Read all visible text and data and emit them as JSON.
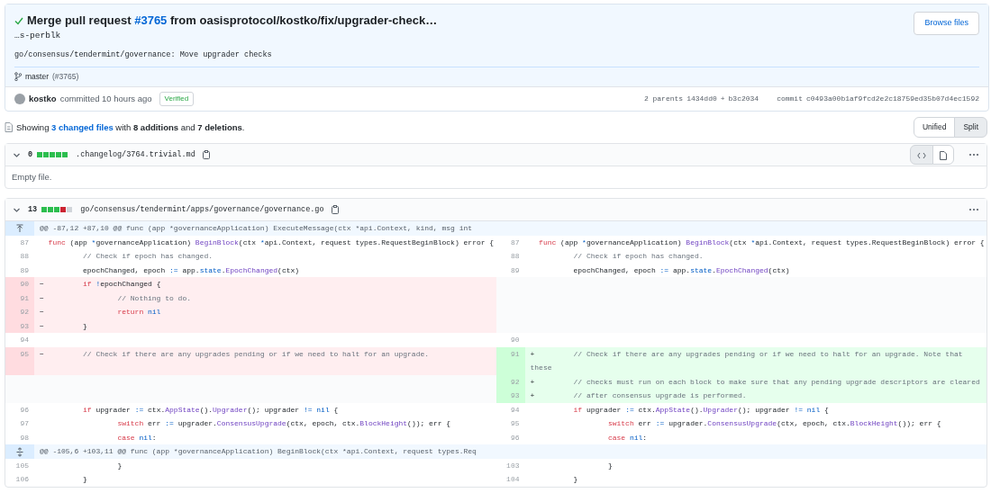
{
  "commit": {
    "title_prefix": "Merge pull request ",
    "pr_link": "#3765",
    "title_suffix": " from oasisprotocol/kostko/fix/upgrader-check…",
    "continuation": "…s-perblk",
    "message": "go/consensus/tendermint/governance: Move upgrader checks",
    "browse_button": "Browse files",
    "branch": "master",
    "branch_pr": "(#3765)",
    "author": "kostko",
    "action": "committed 10 hours ago",
    "verified": "Verified",
    "parents_label": "2 parents",
    "parent_1": "1434dd0",
    "parents_separator": "+",
    "parent_2": "b3c2034",
    "commit_label": "commit",
    "sha": "c0493a00b1af9fcd2e2c18759ed35b07d4ec1592"
  },
  "summary": {
    "prefix": "Showing ",
    "link": "3 changed files",
    "suffix": " with **8 additions** and **7 deletions**."
  },
  "view_toggle": [
    {
      "label": "Unified",
      "selected": false
    },
    {
      "label": "Split",
      "selected": true
    }
  ],
  "files": [
    {
      "count": "0",
      "diffstat": [
        {
          "color": "#2cbe4e"
        },
        {
          "color": "#2cbe4e"
        },
        {
          "color": "#2cbe4e"
        },
        {
          "color": "#2cbe4e"
        },
        {
          "color": "#2cbe4e"
        }
      ],
      "path": ".changelog/3764.trivial.md",
      "expanded": true,
      "body": "Empty file."
    },
    {
      "count": "13",
      "diffstat": [
        {
          "color": "#2cbe4e"
        },
        {
          "color": "#2cbe4e"
        },
        {
          "color": "#2cbe4e"
        },
        {
          "color": "#cb2431"
        },
        {
          "color": "#d1d5da"
        }
      ],
      "path": "go/consensus/tendermint/apps/governance/governance.go",
      "expanded": true,
      "rows": [
        {
          "kind": "hunk",
          "expand_both": false,
          "text": "@@ -87,12 +87,10 @@ func (app *governanceApplication) ExecuteMessage(ctx *api.Context, kind, msg int"
        },
        {
          "kind": "pair",
          "left": {
            "kind": "context",
            "number": "87",
            "tokens": [
              {
                "kind": "keyword",
                "text": "func"
              },
              {
                "kind": "plain",
                "text": " (app "
              },
              {
                "kind": "constant",
                "text": "*"
              },
              {
                "kind": "plain",
                "text": "governanceApplication) "
              },
              {
                "kind": "function",
                "text": "BeginBlock"
              },
              {
                "kind": "plain",
                "text": "(ctx "
              },
              {
                "kind": "constant",
                "text": "*"
              },
              {
                "kind": "plain",
                "text": "api.Context, request types.RequestBeginBlock) error {"
              }
            ]
          },
          "right": {
            "kind": "context",
            "number": "87",
            "tokens": [
              {
                "kind": "keyword",
                "text": "func"
              },
              {
                "kind": "plain",
                "text": " (app "
              },
              {
                "kind": "constant",
                "text": "*"
              },
              {
                "kind": "plain",
                "text": "governanceApplication) "
              },
              {
                "kind": "function",
                "text": "BeginBlock"
              },
              {
                "kind": "plain",
                "text": "(ctx "
              },
              {
                "kind": "constant",
                "text": "*"
              },
              {
                "kind": "plain",
                "text": "api.Context, request types.RequestBeginBlock) error {"
              }
            ]
          }
        },
        {
          "kind": "pair",
          "left": {
            "kind": "context",
            "number": "88",
            "tokens": [
              {
                "kind": "comment",
                "text": "        // Check if epoch has changed."
              }
            ]
          },
          "right": {
            "kind": "context",
            "number": "88",
            "tokens": [
              {
                "kind": "comment",
                "text": "        // Check if epoch has changed."
              }
            ]
          }
        },
        {
          "kind": "pair",
          "left": {
            "kind": "context",
            "number": "89",
            "tokens": [
              {
                "kind": "plain",
                "text": "        epochChanged, epoch "
              },
              {
                "kind": "constant",
                "text": ":="
              },
              {
                "kind": "plain",
                "text": " app."
              },
              {
                "kind": "constant",
                "text": "state"
              },
              {
                "kind": "plain",
                "text": "."
              },
              {
                "kind": "function",
                "text": "EpochChanged"
              },
              {
                "kind": "plain",
                "text": "(ctx)"
              }
            ]
          },
          "right": {
            "kind": "context",
            "number": "89",
            "tokens": [
              {
                "kind": "plain",
                "text": "        epochChanged, epoch "
              },
              {
                "kind": "constant",
                "text": ":="
              },
              {
                "kind": "plain",
                "text": " app."
              },
              {
                "kind": "constant",
                "text": "state"
              },
              {
                "kind": "plain",
                "text": "."
              },
              {
                "kind": "function",
                "text": "EpochChanged"
              },
              {
                "kind": "plain",
                "text": "(ctx)"
              }
            ]
          }
        },
        {
          "kind": "pair",
          "left": {
            "kind": "deletion",
            "number": "90",
            "sign": "−",
            "tokens": [
              {
                "kind": "keyword",
                "text": "        if"
              },
              {
                "kind": "constant",
                "text": " !"
              },
              {
                "kind": "plain",
                "text": "epochChanged {"
              }
            ]
          },
          "right": {
            "kind": "empty"
          }
        },
        {
          "kind": "pair",
          "left": {
            "kind": "deletion",
            "number": "91",
            "sign": "−",
            "tokens": [
              {
                "kind": "comment",
                "text": "                // Nothing to do."
              }
            ]
          },
          "right": {
            "kind": "empty"
          }
        },
        {
          "kind": "pair",
          "left": {
            "kind": "deletion",
            "number": "92",
            "sign": "−",
            "tokens": [
              {
                "kind": "keyword",
                "text": "                return"
              },
              {
                "kind": "constant",
                "text": " nil"
              }
            ]
          },
          "right": {
            "kind": "empty"
          }
        },
        {
          "kind": "pair",
          "left": {
            "kind": "deletion",
            "number": "93",
            "sign": "−",
            "tokens": [
              {
                "kind": "plain",
                "text": "        }"
              }
            ]
          },
          "right": {
            "kind": "empty"
          }
        },
        {
          "kind": "pair",
          "left": {
            "kind": "context",
            "number": "94"
          },
          "right": {
            "kind": "context",
            "number": "90"
          }
        },
        {
          "kind": "pair",
          "left": {
            "kind": "deletion",
            "number": "95",
            "sign": "−",
            "tokens": [
              {
                "kind": "comment",
                "text": "        // Check if there are any upgrades pending or if we need to halt for an upgrade."
              }
            ]
          },
          "right": {
            "kind": "addition",
            "number": "91",
            "sign": "+",
            "tokens": [
              {
                "kind": "comment",
                "text": "        // Check if there are any upgrades pending or if we need to halt for an upgrade. Note that these"
              }
            ]
          }
        },
        {
          "kind": "pair",
          "left": {
            "kind": "empty"
          },
          "right": {
            "kind": "addition",
            "number": "92",
            "sign": "+",
            "tokens": [
              {
                "kind": "comment",
                "text": "        // checks must run on each block to make sure that any pending upgrade descriptors are cleared"
              }
            ]
          }
        },
        {
          "kind": "pair",
          "left": {
            "kind": "empty"
          },
          "right": {
            "kind": "addition",
            "number": "93",
            "sign": "+",
            "tokens": [
              {
                "kind": "comment",
                "text": "        // after consensus upgrade is performed."
              }
            ]
          }
        },
        {
          "kind": "pair",
          "left": {
            "kind": "context",
            "number": "96",
            "tokens": [
              {
                "kind": "keyword",
                "text": "        if"
              },
              {
                "kind": "plain",
                "text": " upgrader "
              },
              {
                "kind": "constant",
                "text": ":="
              },
              {
                "kind": "plain",
                "text": " ctx."
              },
              {
                "kind": "function",
                "text": "AppState"
              },
              {
                "kind": "plain",
                "text": "()."
              },
              {
                "kind": "function",
                "text": "Upgrader"
              },
              {
                "kind": "plain",
                "text": "(); upgrader "
              },
              {
                "kind": "constant",
                "text": "!= nil"
              },
              {
                "kind": "plain",
                "text": " {"
              }
            ]
          },
          "right": {
            "kind": "context",
            "number": "94",
            "tokens": [
              {
                "kind": "keyword",
                "text": "        if"
              },
              {
                "kind": "plain",
                "text": " upgrader "
              },
              {
                "kind": "constant",
                "text": ":="
              },
              {
                "kind": "plain",
                "text": " ctx."
              },
              {
                "kind": "function",
                "text": "AppState"
              },
              {
                "kind": "plain",
                "text": "()."
              },
              {
                "kind": "function",
                "text": "Upgrader"
              },
              {
                "kind": "plain",
                "text": "(); upgrader "
              },
              {
                "kind": "constant",
                "text": "!= nil"
              },
              {
                "kind": "plain",
                "text": " {"
              }
            ]
          }
        },
        {
          "kind": "pair",
          "left": {
            "kind": "context",
            "number": "97",
            "tokens": [
              {
                "kind": "keyword",
                "text": "                switch"
              },
              {
                "kind": "plain",
                "text": " err "
              },
              {
                "kind": "constant",
                "text": ":="
              },
              {
                "kind": "plain",
                "text": " upgrader."
              },
              {
                "kind": "function",
                "text": "ConsensusUpgrade"
              },
              {
                "kind": "plain",
                "text": "(ctx, epoch, ctx."
              },
              {
                "kind": "function",
                "text": "BlockHeight"
              },
              {
                "kind": "plain",
                "text": "()); err {"
              }
            ]
          },
          "right": {
            "kind": "context",
            "number": "95",
            "tokens": [
              {
                "kind": "keyword",
                "text": "                switch"
              },
              {
                "kind": "plain",
                "text": " err "
              },
              {
                "kind": "constant",
                "text": ":="
              },
              {
                "kind": "plain",
                "text": " upgrader."
              },
              {
                "kind": "function",
                "text": "ConsensusUpgrade"
              },
              {
                "kind": "plain",
                "text": "(ctx, epoch, ctx."
              },
              {
                "kind": "function",
                "text": "BlockHeight"
              },
              {
                "kind": "plain",
                "text": "()); err {"
              }
            ]
          }
        },
        {
          "kind": "pair",
          "left": {
            "kind": "context",
            "number": "98",
            "tokens": [
              {
                "kind": "keyword",
                "text": "                case"
              },
              {
                "kind": "constant",
                "text": " nil"
              },
              {
                "kind": "plain",
                "text": ":"
              }
            ]
          },
          "right": {
            "kind": "context",
            "number": "96",
            "tokens": [
              {
                "kind": "keyword",
                "text": "                case"
              },
              {
                "kind": "constant",
                "text": " nil"
              },
              {
                "kind": "plain",
                "text": ":"
              }
            ]
          }
        },
        {
          "kind": "hunk",
          "expand_both": true,
          "text": "@@ -105,6 +103,11 @@ func (app *governanceApplication) BeginBlock(ctx *api.Context, request types.Req"
        },
        {
          "kind": "pair",
          "left": {
            "kind": "context",
            "number": "105",
            "tokens": [
              {
                "kind": "plain",
                "text": "                }"
              }
            ]
          },
          "right": {
            "kind": "context",
            "number": "103",
            "tokens": [
              {
                "kind": "plain",
                "text": "                }"
              }
            ]
          }
        },
        {
          "kind": "pair",
          "left": {
            "kind": "context",
            "number": "106",
            "tokens": [
              {
                "kind": "plain",
                "text": "        }"
              }
            ]
          },
          "right": {
            "kind": "context",
            "number": "104",
            "tokens": [
              {
                "kind": "plain",
                "text": "        }"
              }
            ]
          }
        }
      ]
    }
  ]
}
